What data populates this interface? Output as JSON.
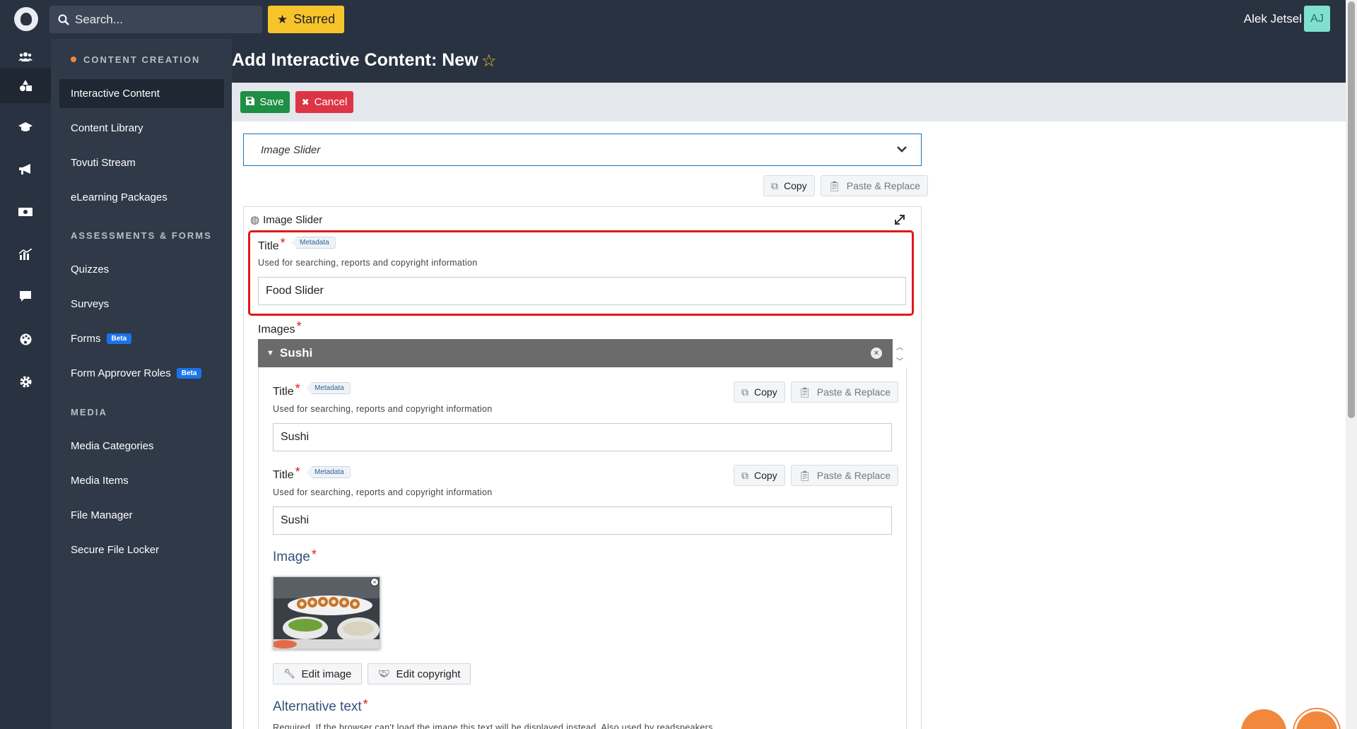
{
  "topbar": {
    "search_placeholder": "Search...",
    "starred_label": "Starred",
    "user_name": "Alek Jetsel",
    "avatar_initials": "AJ"
  },
  "rail": {
    "icons": [
      "users-icon",
      "shapes-icon",
      "graduation-cap-icon",
      "megaphone-icon",
      "money-icon",
      "chart-icon",
      "comment-icon",
      "palette-icon",
      "gear-icon"
    ],
    "active": "shapes-icon"
  },
  "sidebar": {
    "sections": [
      {
        "title": "CONTENT CREATION",
        "items": [
          {
            "label": "Interactive Content",
            "active": true
          },
          {
            "label": "Content Library"
          },
          {
            "label": "Tovuti Stream"
          },
          {
            "label": "eLearning Packages"
          }
        ]
      },
      {
        "title": "ASSESSMENTS & FORMS",
        "items": [
          {
            "label": "Quizzes"
          },
          {
            "label": "Surveys"
          },
          {
            "label": "Forms",
            "badge": "Beta"
          },
          {
            "label": "Form Approver Roles",
            "badge": "Beta"
          }
        ]
      },
      {
        "title": "MEDIA",
        "items": [
          {
            "label": "Media Categories"
          },
          {
            "label": "Media Items"
          },
          {
            "label": "File Manager"
          },
          {
            "label": "Secure File Locker"
          }
        ]
      }
    ]
  },
  "header": {
    "title": "Add Interactive Content: New"
  },
  "toolbar": {
    "save_label": "Save",
    "cancel_label": "Cancel"
  },
  "content_type": {
    "selected": "Image Slider",
    "copy_label": "Copy",
    "paste_label": "Paste & Replace"
  },
  "editor": {
    "panel_title": "Image Slider",
    "title_field": {
      "label": "Title",
      "tag": "Metadata",
      "help": "Used for searching, reports and copyright information",
      "value": "Food Slider"
    },
    "images_label": "Images",
    "slide": {
      "name": "Sushi",
      "fields": [
        {
          "label": "Title",
          "tag": "Metadata",
          "help": "Used for searching, reports and copyright information",
          "value": "Sushi",
          "copy_label": "Copy",
          "paste_label": "Paste & Replace"
        },
        {
          "label": "Title",
          "tag": "Metadata",
          "help": "Used for searching, reports and copyright information",
          "value": "Sushi",
          "copy_label": "Copy",
          "paste_label": "Paste & Replace"
        }
      ],
      "image_label": "Image",
      "edit_image_label": "Edit image",
      "edit_copyright_label": "Edit copyright",
      "alt_text_label": "Alternative text",
      "alt_text_help": "Required. If the browser can't load the image this text will be displayed instead. Also used by readspeakers."
    }
  },
  "colors": {
    "topbar": "#293241",
    "sidebar": "#2f3948",
    "accent_yellow": "#f7c52b",
    "save_green": "#1e8f44",
    "cancel_red": "#dc3545",
    "highlight_red": "#e01818",
    "fab_orange": "#f0883e"
  }
}
